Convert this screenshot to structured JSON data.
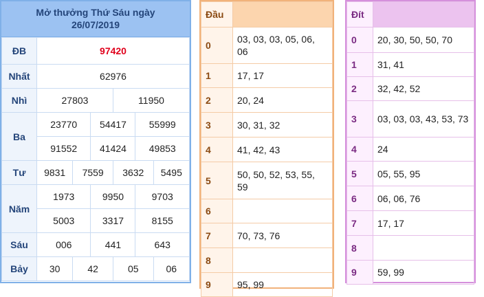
{
  "results": {
    "title_line1": "Mở thưởng Thứ Sáu ngày",
    "title_line2": "26/07/2019",
    "prizes": {
      "db": {
        "label": "ĐB",
        "values": [
          "97420"
        ]
      },
      "nhat": {
        "label": "Nhất",
        "values": [
          "62976"
        ]
      },
      "nhi": {
        "label": "Nhì",
        "values": [
          "27803",
          "11950"
        ]
      },
      "ba": {
        "label": "Ba",
        "values": [
          "23770",
          "54417",
          "55999",
          "91552",
          "41424",
          "49853"
        ]
      },
      "tu": {
        "label": "Tư",
        "values": [
          "9831",
          "7559",
          "3632",
          "5495"
        ]
      },
      "nam": {
        "label": "Năm",
        "values": [
          "1973",
          "9950",
          "9703",
          "5003",
          "3317",
          "8155"
        ]
      },
      "sau": {
        "label": "Sáu",
        "values": [
          "006",
          "441",
          "643"
        ]
      },
      "bay": {
        "label": "Bảy",
        "values": [
          "30",
          "42",
          "05",
          "06"
        ]
      }
    }
  },
  "dau": {
    "header": "Đầu",
    "rows": [
      {
        "k": "0",
        "v": "03, 03, 03, 05, 06, 06"
      },
      {
        "k": "1",
        "v": "17, 17"
      },
      {
        "k": "2",
        "v": "20, 24"
      },
      {
        "k": "3",
        "v": "30, 31, 32"
      },
      {
        "k": "4",
        "v": "41, 42, 43"
      },
      {
        "k": "5",
        "v": "50, 50, 52, 53, 55, 59"
      },
      {
        "k": "6",
        "v": ""
      },
      {
        "k": "7",
        "v": "70, 73, 76"
      },
      {
        "k": "8",
        "v": ""
      },
      {
        "k": "9",
        "v": "95, 99"
      }
    ]
  },
  "dit": {
    "header": "Đít",
    "rows": [
      {
        "k": "0",
        "v": "20, 30, 50, 50, 70"
      },
      {
        "k": "1",
        "v": "31, 41"
      },
      {
        "k": "2",
        "v": "32, 42, 52"
      },
      {
        "k": "3",
        "v": "03, 03, 03, 43, 53, 73"
      },
      {
        "k": "4",
        "v": "24"
      },
      {
        "k": "5",
        "v": "05, 55, 95"
      },
      {
        "k": "6",
        "v": "06, 06, 76"
      },
      {
        "k": "7",
        "v": "17, 17"
      },
      {
        "k": "8",
        "v": ""
      },
      {
        "k": "9",
        "v": "59, 99"
      }
    ]
  }
}
